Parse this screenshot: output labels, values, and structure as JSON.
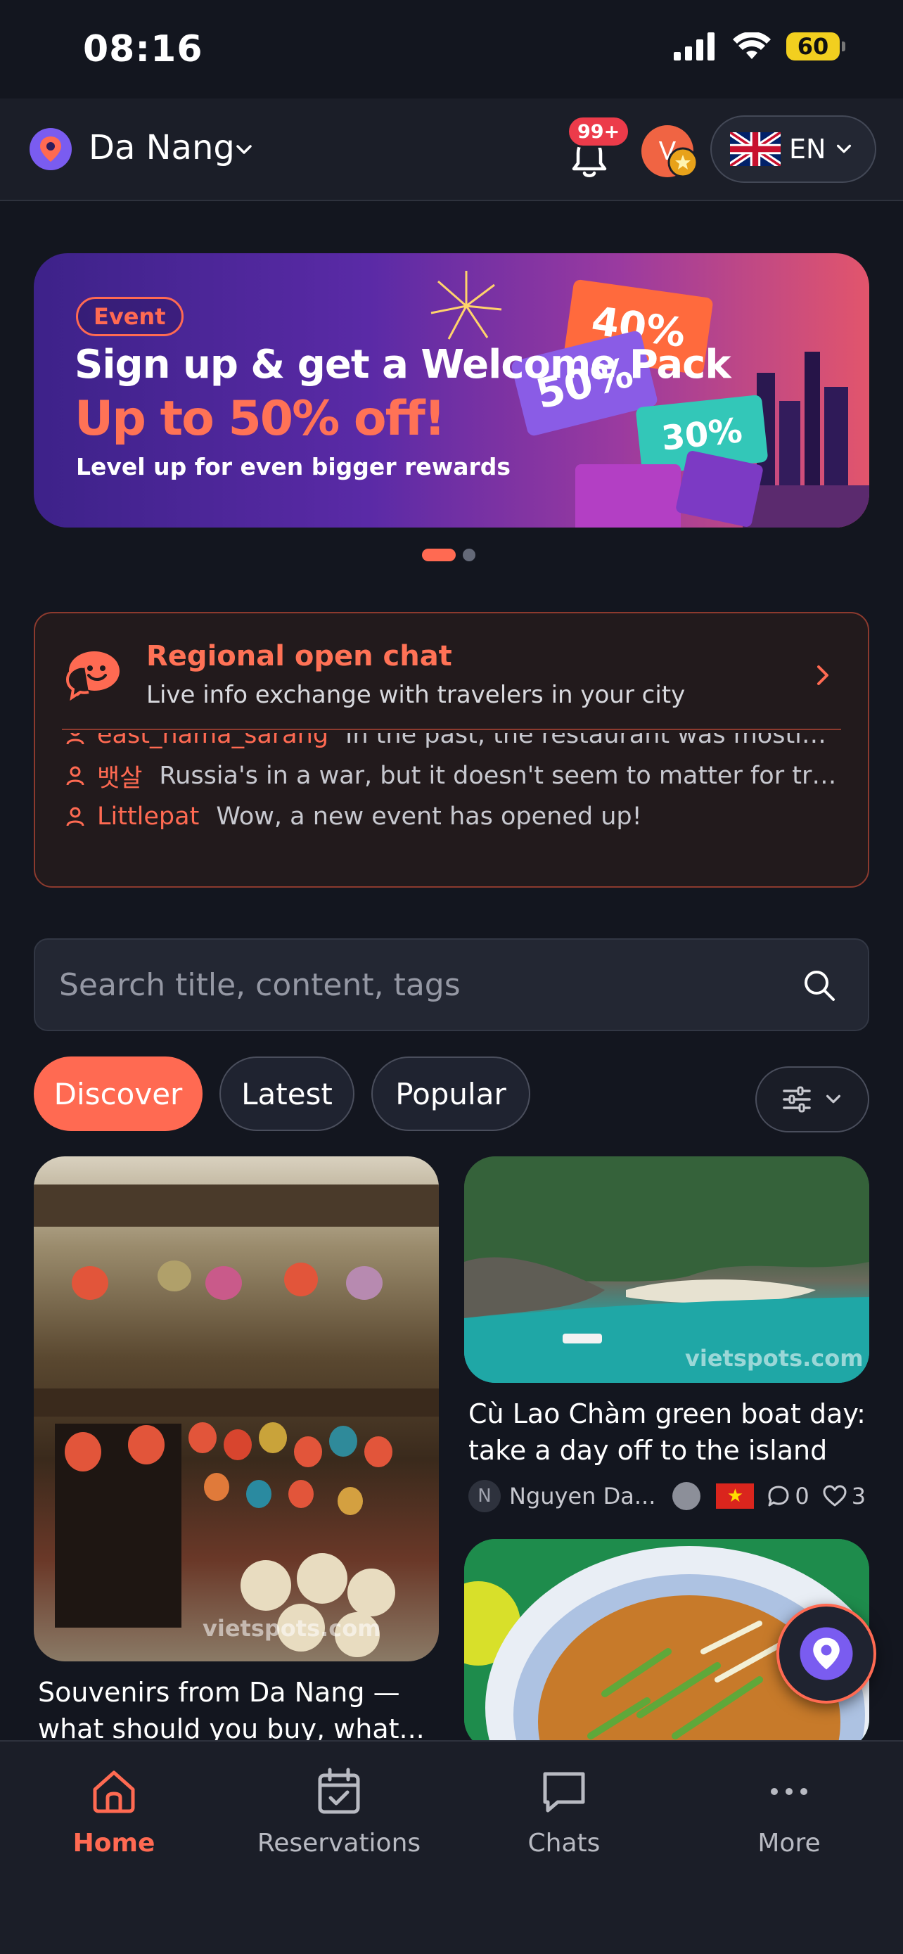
{
  "status_bar": {
    "time": "08:16",
    "battery": "60"
  },
  "header": {
    "city": "Da Nang",
    "notification_badge": "99+",
    "avatar_initial": "V",
    "language": "EN"
  },
  "banner": {
    "tag": "Event",
    "title": "Sign up & get a Welcome Pack",
    "headline": "Up to 50% off!",
    "subtitle": "Level up for even bigger rewards",
    "coupons": [
      "40%",
      "50%",
      "30%"
    ],
    "slide_count": 2,
    "active_slide": 1
  },
  "open_chat": {
    "title": "Regional open chat",
    "subtitle": "Live info exchange with travelers in your city",
    "messages": [
      {
        "user": "east_nama_sarang",
        "text": "In the past, the restaurant was mostly Korea..."
      },
      {
        "user": "뱃살",
        "text": "Russia's in a war, but it doesn't seem to matter for travel, do..."
      },
      {
        "user": "Littlepat",
        "text": "Wow, a new event has opened up!"
      }
    ]
  },
  "search": {
    "placeholder": "Search title, content, tags"
  },
  "tabs": [
    {
      "label": "Discover",
      "active": true
    },
    {
      "label": "Latest",
      "active": false
    },
    {
      "label": "Popular",
      "active": false
    }
  ],
  "posts": [
    {
      "title": "Souvenirs from Da Nang — what should you buy, what...",
      "watermark": "vietspots.com"
    },
    {
      "title": "Cù Lao Chàm green boat day: take a day off to the island",
      "watermark": "vietspots.com",
      "author_initial": "N",
      "author": "Nguyen Da...",
      "comments": "0",
      "likes": "3"
    }
  ],
  "bottom_nav": [
    {
      "label": "Home",
      "icon": "home-icon",
      "active": true
    },
    {
      "label": "Reservations",
      "icon": "calendar-icon",
      "active": false
    },
    {
      "label": "Chats",
      "icon": "chat-bubble-icon",
      "active": false
    },
    {
      "label": "More",
      "icon": "more-dots-icon",
      "active": false
    }
  ],
  "colors": {
    "accent": "#ff6a52",
    "background": "#13161f",
    "surface": "#232733"
  }
}
